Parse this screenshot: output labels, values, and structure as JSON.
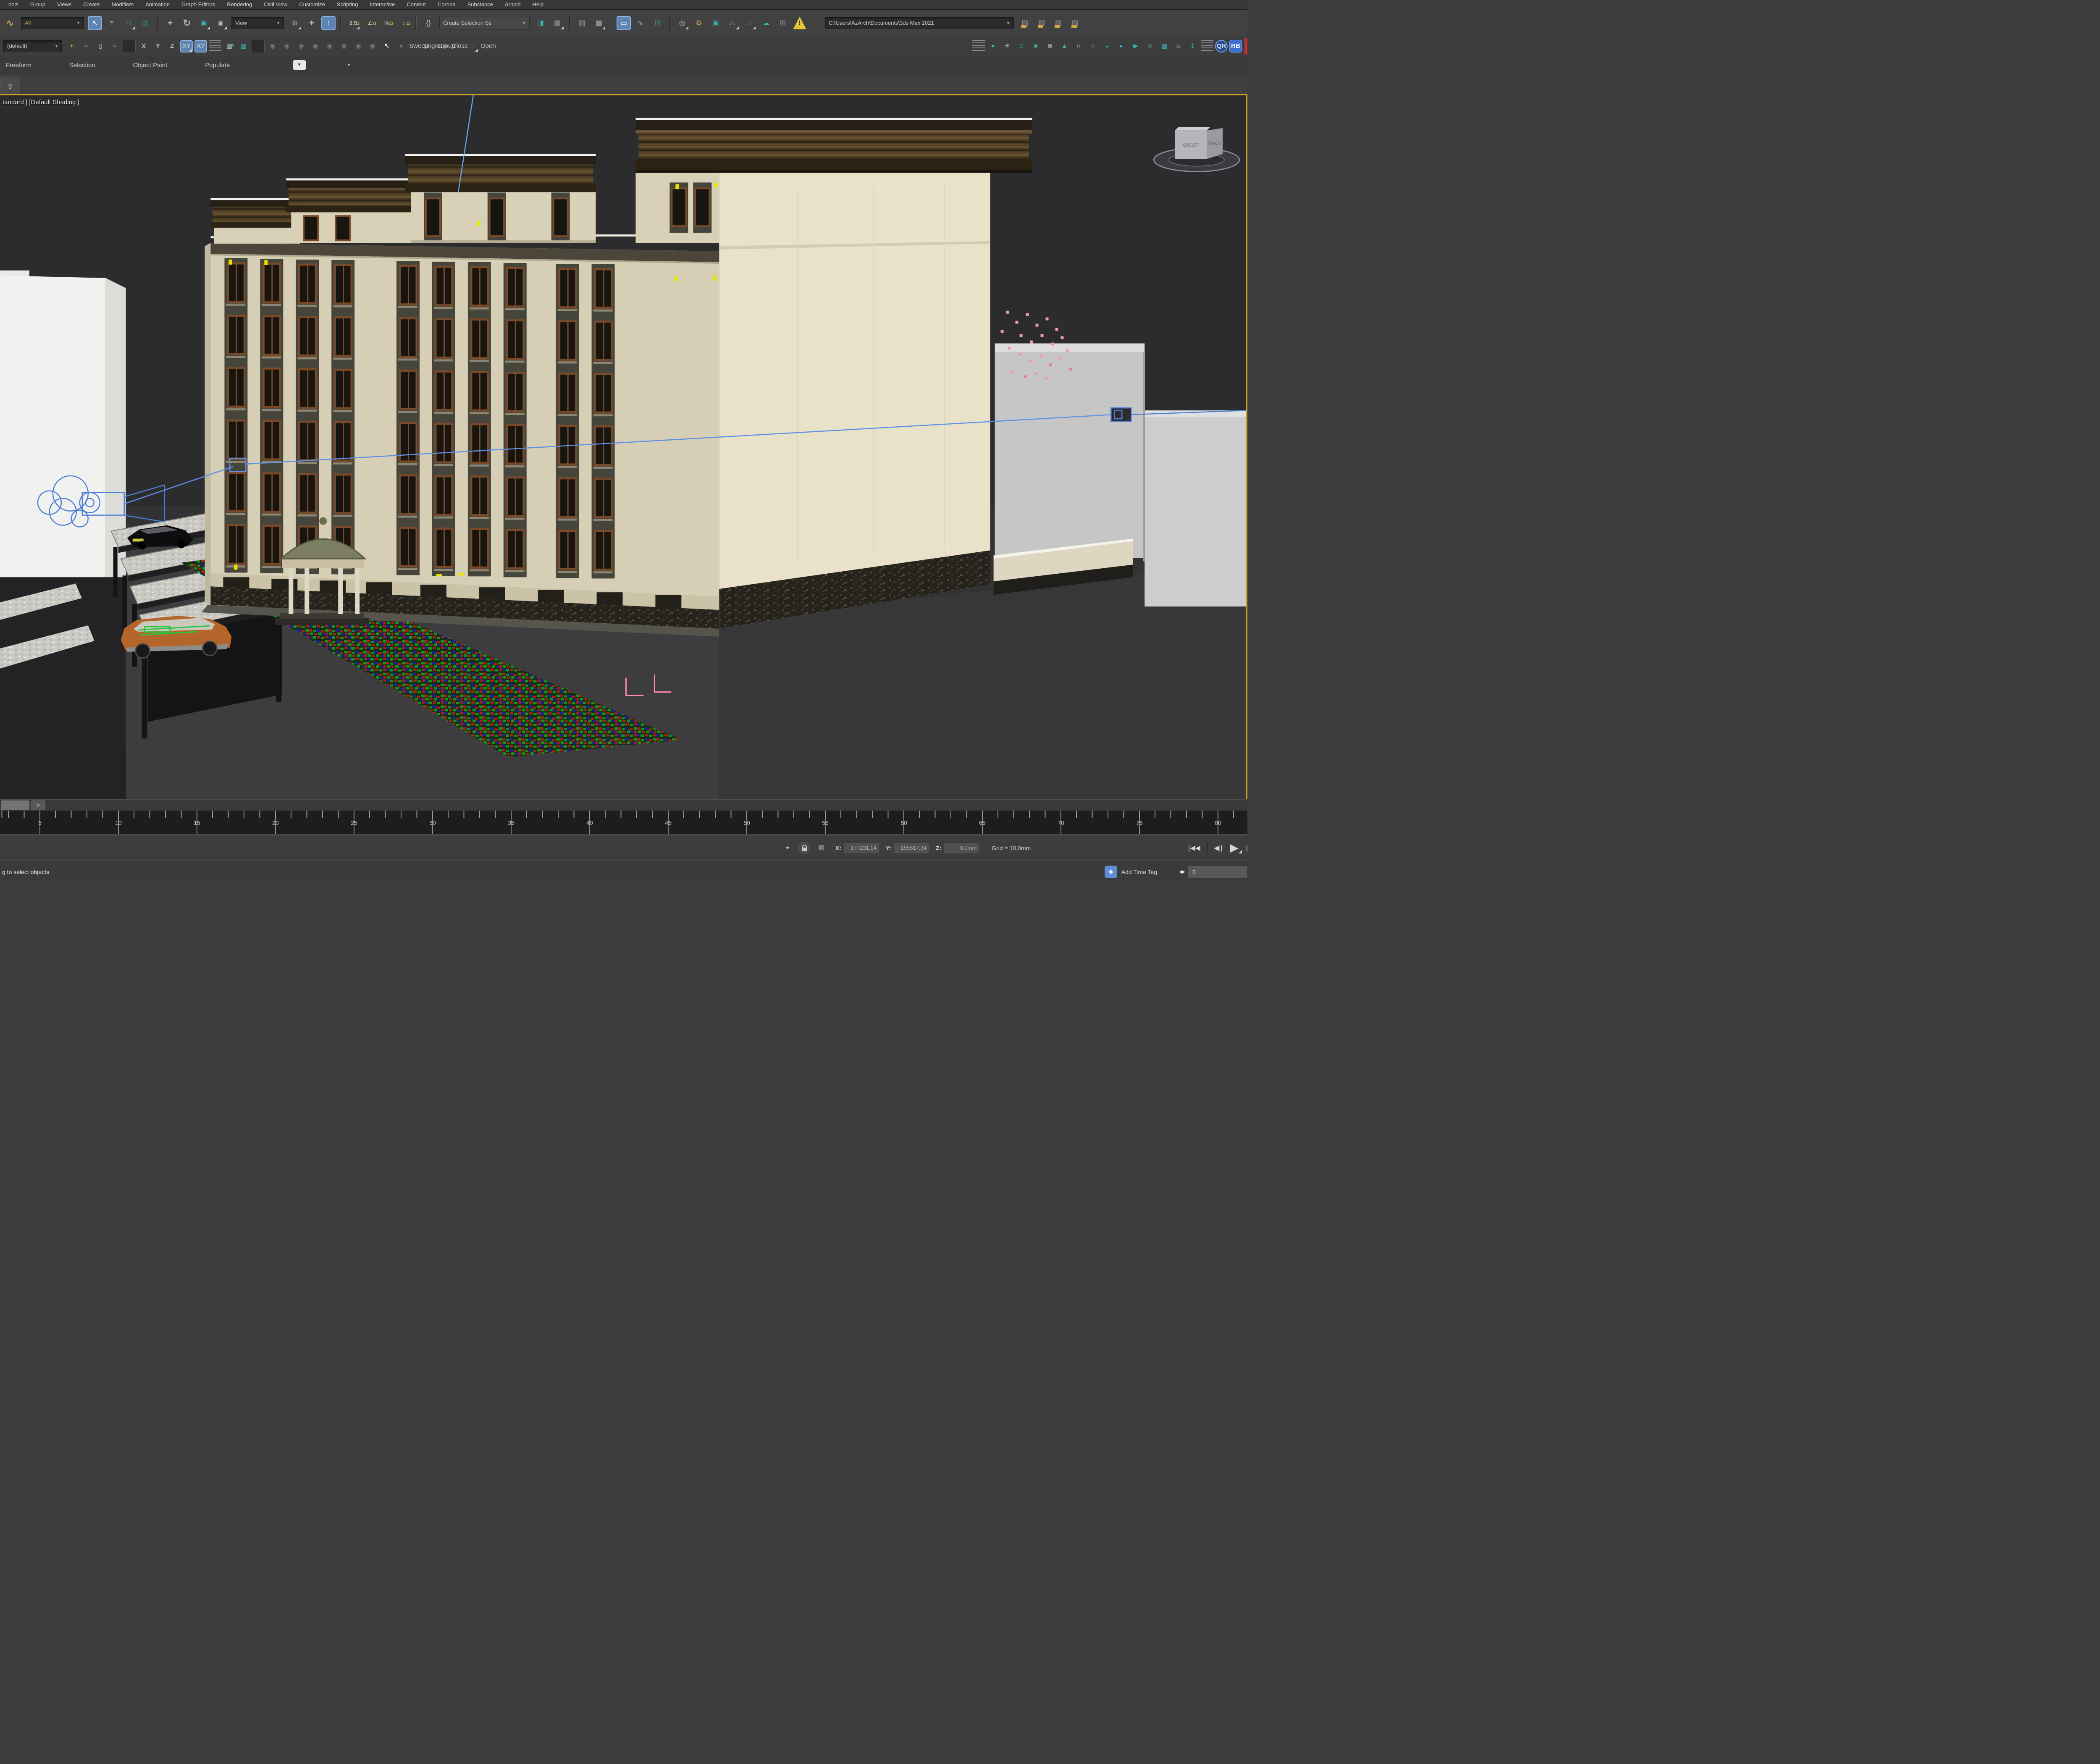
{
  "menu": {
    "items": [
      "ools",
      "Group",
      "Views",
      "Create",
      "Modifiers",
      "Animation",
      "Graph Editors",
      "Rendering",
      "Civil View",
      "Customize",
      "Scripting",
      "Interactive",
      "Content",
      "Corona",
      "Substance",
      "Arnold",
      "Help"
    ]
  },
  "toolbar1": {
    "filter_value": "All",
    "refcoord_value": "View",
    "selection_set_value": "Create Selection Se",
    "project_path": "C:\\Users\\AzArch\\Documents\\3ds Max 2021",
    "seg_a": [
      {
        "n": "select-and-link-icon",
        "g": "∿",
        "c": "gold big"
      }
    ],
    "seg_b": [
      {
        "n": "select-object-icon",
        "g": "↖",
        "c": "act"
      },
      {
        "n": "select-by-name-icon",
        "g": "≡"
      },
      {
        "n": "rectangular-selection-region-icon",
        "g": "□",
        "c": "teal fo"
      },
      {
        "n": "window-crossing-icon",
        "g": "◫",
        "c": "teal"
      },
      {
        "n": "divider",
        "g": "",
        "c": "sep"
      },
      {
        "n": "select-and-move-icon",
        "g": "+",
        "c": "big"
      },
      {
        "n": "select-and-rotate-icon",
        "g": "↻",
        "c": "big"
      },
      {
        "n": "select-and-scale-icon",
        "g": "▣",
        "c": "teal fo"
      },
      {
        "n": "select-and-place-icon",
        "g": "◉",
        "c": "fo"
      }
    ],
    "seg_c": [
      {
        "n": "use-pivot-point-center-icon",
        "g": "⊕",
        "c": "fo"
      },
      {
        "n": "select-and-manipulate-icon",
        "g": "+",
        "c": "big"
      },
      {
        "n": "keyboard-override-icon",
        "g": "↑",
        "c": "act"
      },
      {
        "n": "divider",
        "g": "",
        "c": "sep"
      },
      {
        "n": "snap-toggle-25d-icon",
        "g": "2.5",
        "c": "snap fo"
      },
      {
        "n": "angle-snap-icon",
        "g": "∠",
        "c": "snap"
      },
      {
        "n": "percent-snap-icon",
        "g": "%",
        "c": "snap"
      },
      {
        "n": "spinner-snap-icon",
        "g": "↕",
        "c": "snap"
      },
      {
        "n": "divider",
        "g": "",
        "c": "sep"
      },
      {
        "n": "edit-named-selection-sets-icon",
        "g": "{}"
      }
    ],
    "seg_d": [
      {
        "n": "mirror-icon",
        "g": "◨",
        "c": "teal"
      },
      {
        "n": "align-icon",
        "g": "▦",
        "c": "fo"
      },
      {
        "n": "divider",
        "g": "",
        "c": "sep"
      },
      {
        "n": "toggle-scene-explorer-icon",
        "g": "▤"
      },
      {
        "n": "toggle-layer-explorer-icon",
        "g": "▥",
        "c": "fo"
      },
      {
        "n": "divider",
        "g": "",
        "c": "sep"
      },
      {
        "n": "toggle-ribbon-icon",
        "g": "▭",
        "c": "act"
      },
      {
        "n": "curve-editor-icon",
        "g": "∿"
      },
      {
        "n": "schematic-view-icon",
        "g": "⊟",
        "c": "teal"
      },
      {
        "n": "divider",
        "g": "",
        "c": "sep"
      },
      {
        "n": "material-editor-icon",
        "g": "◎",
        "c": "fo"
      },
      {
        "n": "render-setup-icon",
        "g": "⚙",
        "c": "gold"
      },
      {
        "n": "rendered-frame-window-icon",
        "g": "▣",
        "c": "teal"
      },
      {
        "n": "render-production-icon",
        "g": "♨",
        "c": "fo"
      },
      {
        "n": "render-iterative-icon",
        "g": "♨",
        "c": "dim fo"
      },
      {
        "n": "render-in-cloud-icon",
        "g": "☁",
        "c": "teal"
      },
      {
        "n": "render-gallery-icon",
        "g": "⊞"
      },
      {
        "n": "warning-icon",
        "g": "!",
        "c": "warn"
      }
    ],
    "seg_e": [
      {
        "n": "folder-project-icon",
        "g": "▤",
        "c": "goldac"
      },
      {
        "n": "folder-open-icon",
        "g": "▤",
        "c": "goldac"
      },
      {
        "n": "folder-save-icon",
        "g": "▤",
        "c": "goldac"
      },
      {
        "n": "folder-options-icon",
        "g": "▤",
        "c": "goldac"
      }
    ]
  },
  "toolbar2": {
    "workspace_value": "(default)",
    "seg_a": [
      {
        "n": "plus-arrows-icon",
        "g": "+",
        "c": "gold big"
      },
      {
        "n": "stack-back-icon",
        "g": "≈",
        "c": "dim big"
      },
      {
        "n": "select-rect-icon",
        "g": "▯"
      },
      {
        "n": "stack-front-icon",
        "g": "≈",
        "c": "dim big"
      },
      {
        "n": "divider",
        "g": "",
        "c": "sep"
      },
      {
        "n": "axis-x-button",
        "g": "X",
        "c": "ax"
      },
      {
        "n": "axis-y-button",
        "g": "Y",
        "c": "ax"
      },
      {
        "n": "axis-z-button",
        "g": "Z",
        "c": "ax"
      },
      {
        "n": "axis-plane-button",
        "g": "XY",
        "c": "ax act fo"
      },
      {
        "n": "snaps-axis-constraint-toggle",
        "g": "X?",
        "c": "ax act"
      },
      {
        "n": "divider",
        "g": "",
        "c": "dsep"
      },
      {
        "n": "grid-array-icon",
        "g": "▦",
        "c": "tealtx"
      },
      {
        "n": "grid-range-icon",
        "g": "▦",
        "c": "teal"
      },
      {
        "n": "divider",
        "g": "",
        "c": "sep"
      },
      {
        "n": "feather-icon",
        "g": "◉",
        "c": "dim"
      },
      {
        "n": "capsule-icon",
        "g": "◉",
        "c": "dim"
      },
      {
        "n": "wire-sphere-icon",
        "g": "◉",
        "c": "dim"
      },
      {
        "n": "noise-sphere-icon",
        "g": "◉",
        "c": "dim"
      },
      {
        "n": "checker-icon",
        "g": "◉",
        "c": "dim"
      },
      {
        "n": "spline-icon",
        "g": "◉",
        "c": "dim"
      },
      {
        "n": "scatter-icon",
        "g": "◉",
        "c": "dim"
      },
      {
        "n": "diamond-cross-icon",
        "g": "◉",
        "c": "dim"
      },
      {
        "n": "flag-cursor-icon",
        "g": "↖",
        "c": "white big"
      },
      {
        "n": "sphere-icon",
        "g": "●",
        "c": "dim big"
      }
    ],
    "buttons": [
      {
        "n": "sweep-button",
        "g": "Sweep",
        "c": "tbt"
      },
      {
        "n": "ungroup-button",
        "g": "Ungroup",
        "c": "tbt"
      },
      {
        "n": "group-button",
        "g": "Group",
        "c": "tbt"
      },
      {
        "n": "close-button",
        "g": "Close",
        "c": "tbt"
      },
      {
        "n": "dotted-circle-icon",
        "g": "◌",
        "c": "teal fo big"
      },
      {
        "n": "open-button",
        "g": "Open",
        "c": "tbt"
      }
    ],
    "seg_c": [
      {
        "n": "divider",
        "g": "",
        "c": "dsep"
      },
      {
        "n": "light-bulb-icon",
        "g": "●",
        "c": "teal"
      },
      {
        "n": "sun-icon",
        "g": "☀"
      },
      {
        "n": "people-icon",
        "g": "☺",
        "c": "teal"
      },
      {
        "n": "tree-icon",
        "g": "♣",
        "c": "teal"
      },
      {
        "n": "list-icon",
        "g": "≣"
      },
      {
        "n": "pine-tree-icon",
        "g": "▲",
        "c": "teal"
      },
      {
        "n": "arch-icon",
        "g": "∩"
      },
      {
        "n": "torus-icon",
        "g": "○"
      },
      {
        "n": "half-sphere-icon",
        "g": "◒",
        "c": "teal"
      },
      {
        "n": "box-arrow-icon",
        "g": "▸",
        "c": "teal"
      },
      {
        "n": "play-clip-icon",
        "g": "▶",
        "c": "teal"
      },
      {
        "n": "people-add-icon",
        "g": "☺",
        "c": "teal"
      },
      {
        "n": "wall-icon",
        "g": "▦",
        "c": "teal"
      },
      {
        "n": "teapot-icon",
        "g": "♨"
      },
      {
        "n": "lamp-icon",
        "g": "↥",
        "c": "teal"
      },
      {
        "n": "divider",
        "g": "",
        "c": "dsep"
      },
      {
        "n": "qr-badge",
        "g": "QR",
        "c": "qr"
      },
      {
        "n": "rb-badge",
        "g": "RB",
        "c": "rb"
      }
    ]
  },
  "ribbon": {
    "tabs": [
      "Freeform",
      "Selection",
      "Object Paint",
      "Populate"
    ]
  },
  "gtab_label": "g",
  "viewport": {
    "label": "tandard ] [Default Shading ]",
    "viewcube": {
      "left": "WEST",
      "right": "BACK"
    }
  },
  "timeline": {
    "slider_button": ">",
    "labels": [
      "5",
      "10",
      "15",
      "20",
      "25",
      "30",
      "35",
      "40",
      "45",
      "50",
      "55",
      "60",
      "65",
      "70",
      "75",
      "80"
    ]
  },
  "status": {
    "x_label": "X:",
    "y_label": "Y:",
    "z_label": "Z:",
    "x_value": "177231,14",
    "y_value": "155517,34",
    "z_value": "0,0mm",
    "grid_label": "Grid = 10,0mm",
    "prompt": "g to select objects",
    "add_time_tag": "Add Time Tag",
    "frame_value": "0"
  }
}
